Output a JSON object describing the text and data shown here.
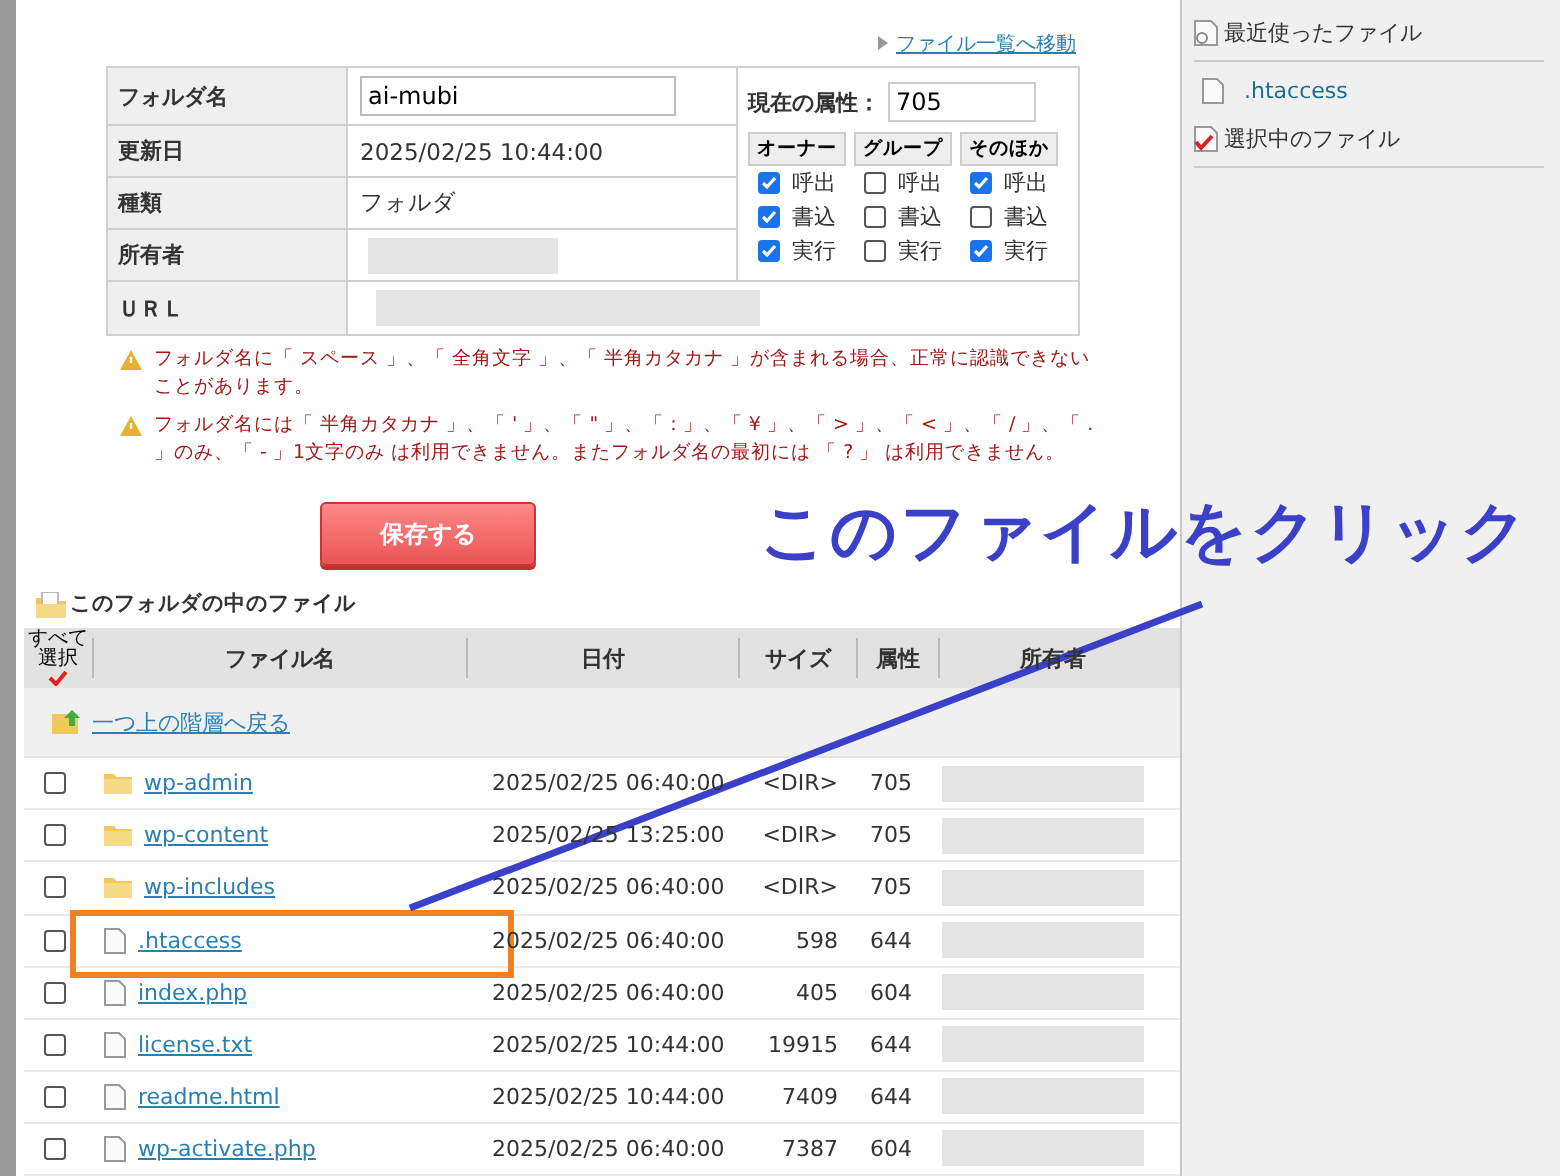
{
  "top_link": "ファイル一覧へ移動",
  "info": {
    "rows": [
      {
        "label": "フォルダ名",
        "kind": "input",
        "value": "ai-mubi"
      },
      {
        "label": "更新日",
        "kind": "text",
        "value": "2025/02/25 10:44:00"
      },
      {
        "label": "種類",
        "kind": "text",
        "value": "フォルダ"
      },
      {
        "label": "所有者",
        "kind": "hidden"
      },
      {
        "label": "ＵＲＬ",
        "kind": "hidden"
      }
    ],
    "attribute_label": "現在の属性：",
    "attribute_value": "705",
    "groups": [
      {
        "label": "オーナー",
        "perms": [
          {
            "label": "呼出",
            "checked": true
          },
          {
            "label": "書込",
            "checked": true
          },
          {
            "label": "実行",
            "checked": true
          }
        ]
      },
      {
        "label": "グループ",
        "perms": [
          {
            "label": "呼出",
            "checked": false
          },
          {
            "label": "書込",
            "checked": false
          },
          {
            "label": "実行",
            "checked": false
          }
        ]
      },
      {
        "label": "そのほか",
        "perms": [
          {
            "label": "呼出",
            "checked": true
          },
          {
            "label": "書込",
            "checked": false
          },
          {
            "label": "実行",
            "checked": true
          }
        ]
      }
    ]
  },
  "warnings": [
    "フォルダ名に「 スペース 」、「 全角文字 」、「 半角カタカナ 」が含まれる場合、正常に認識できないことがあります。",
    "フォルダ名には「 半角カタカナ 」、「 ' 」、「 \" 」、「 : 」、「 ¥ 」、「 > 」、「 < 」、「 / 」、「 . 」のみ、「 - 」1文字のみ は利用できません。またフォルダ名の最初には 「 ? 」 は利用できません。"
  ],
  "save_button": "保存する",
  "section_title": "このフォルダの中のファイル",
  "table": {
    "select_all": "すべて選択",
    "columns": [
      "ファイル名",
      "日付",
      "サイズ",
      "属性",
      "所有者"
    ],
    "up_link": "一つ上の階層へ戻る",
    "rows": [
      {
        "kind": "folder",
        "name": "wp-admin",
        "date": "2025/02/25 06:40:00",
        "size": "<DIR>",
        "attr": "705",
        "checked": false
      },
      {
        "kind": "folder",
        "name": "wp-content",
        "date": "2025/02/25 13:25:00",
        "size": "<DIR>",
        "attr": "705",
        "checked": false
      },
      {
        "kind": "folder",
        "name": "wp-includes",
        "date": "2025/02/25 06:40:00",
        "size": "<DIR>",
        "attr": "705",
        "checked": false
      },
      {
        "kind": "file",
        "name": ".htaccess",
        "date": "2025/02/25 06:40:00",
        "size": "598",
        "attr": "644",
        "checked": false
      },
      {
        "kind": "file",
        "name": "index.php",
        "date": "2025/02/25 06:40:00",
        "size": "405",
        "attr": "604",
        "checked": false
      },
      {
        "kind": "file",
        "name": "license.txt",
        "date": "2025/02/25 10:44:00",
        "size": "19915",
        "attr": "644",
        "checked": false
      },
      {
        "kind": "file",
        "name": "readme.html",
        "date": "2025/02/25 10:44:00",
        "size": "7409",
        "attr": "644",
        "checked": false
      },
      {
        "kind": "file",
        "name": "wp-activate.php",
        "date": "2025/02/25 06:40:00",
        "size": "7387",
        "attr": "604",
        "checked": false
      }
    ]
  },
  "sidebar": {
    "recent_title": "最近使ったファイル",
    "recent": [
      ".htaccess"
    ],
    "selected_title": "選択中のファイル"
  },
  "annotation": {
    "text": "このファイルをクリック"
  }
}
